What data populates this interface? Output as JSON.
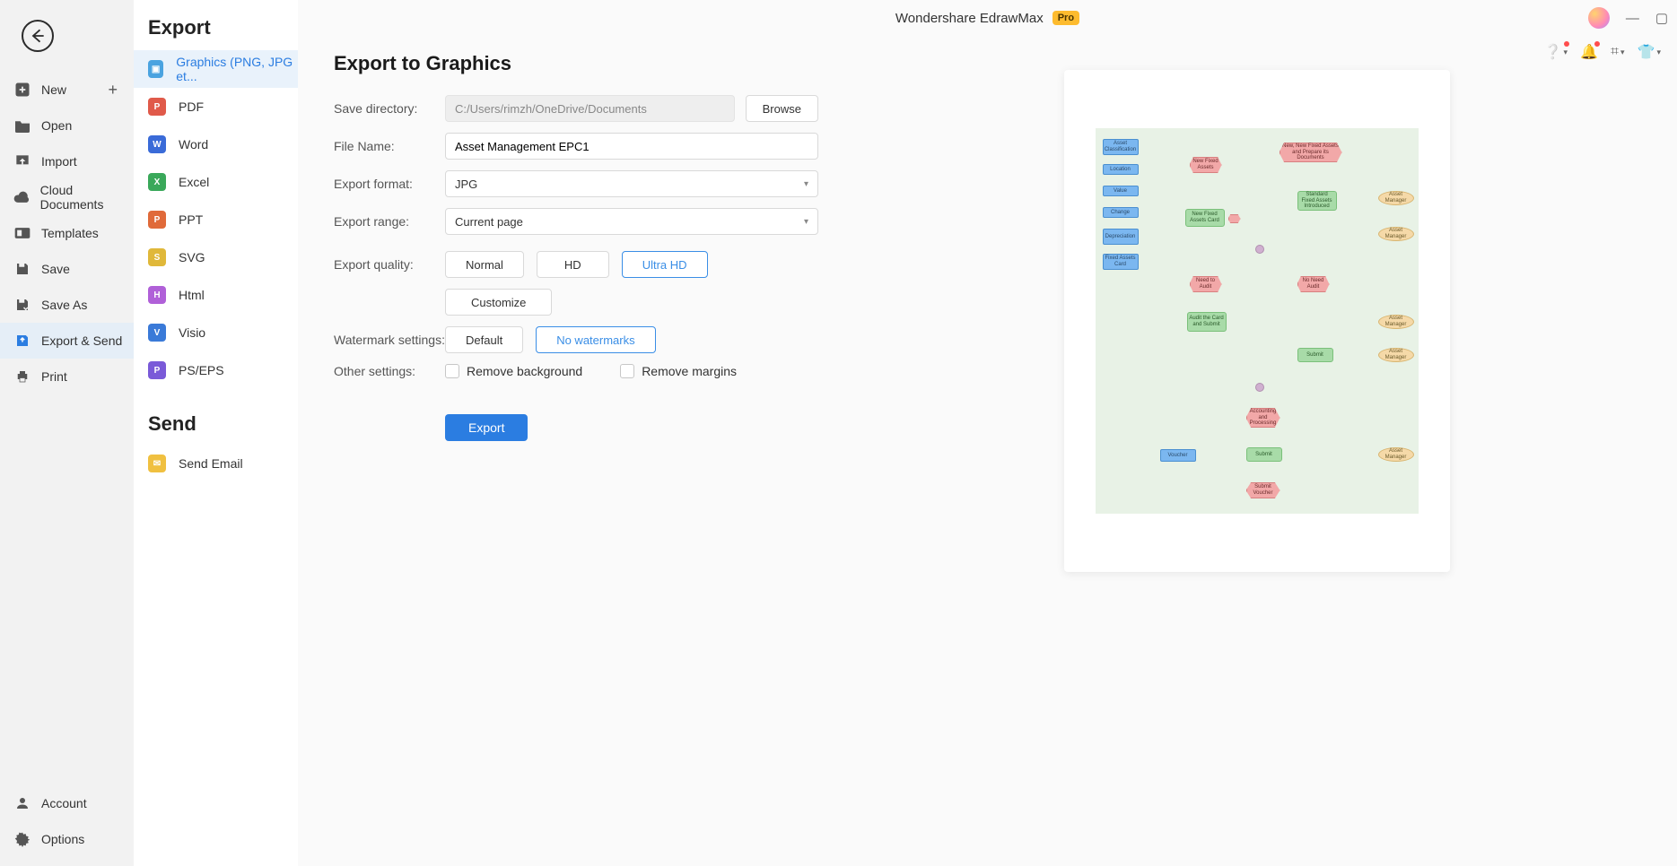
{
  "app": {
    "title": "Wondershare EdrawMax",
    "badge": "Pro"
  },
  "nav": {
    "items": [
      {
        "id": "new",
        "label": "New"
      },
      {
        "id": "open",
        "label": "Open"
      },
      {
        "id": "import",
        "label": "Import"
      },
      {
        "id": "cloud",
        "label": "Cloud Documents"
      },
      {
        "id": "templates",
        "label": "Templates"
      },
      {
        "id": "save",
        "label": "Save"
      },
      {
        "id": "saveas",
        "label": "Save As"
      },
      {
        "id": "export",
        "label": "Export & Send"
      },
      {
        "id": "print",
        "label": "Print"
      }
    ],
    "footer": [
      {
        "id": "account",
        "label": "Account"
      },
      {
        "id": "options",
        "label": "Options"
      }
    ]
  },
  "export_list": {
    "heading": "Export",
    "items": [
      {
        "id": "graphics",
        "label": "Graphics (PNG, JPG et...",
        "color": "#4aa3e0"
      },
      {
        "id": "pdf",
        "label": "PDF",
        "color": "#e05a4a"
      },
      {
        "id": "word",
        "label": "Word",
        "color": "#3a6bd8"
      },
      {
        "id": "excel",
        "label": "Excel",
        "color": "#3aa85a"
      },
      {
        "id": "ppt",
        "label": "PPT",
        "color": "#e06a3a"
      },
      {
        "id": "svg",
        "label": "SVG",
        "color": "#e0b83a"
      },
      {
        "id": "html",
        "label": "Html",
        "color": "#b060d8"
      },
      {
        "id": "visio",
        "label": "Visio",
        "color": "#3a7ad8"
      },
      {
        "id": "pseps",
        "label": "PS/EPS",
        "color": "#7a5ad8"
      }
    ],
    "send_heading": "Send",
    "send_items": [
      {
        "id": "email",
        "label": "Send Email",
        "color": "#f0c040"
      }
    ]
  },
  "form": {
    "title": "Export to Graphics",
    "labels": {
      "save_dir": "Save directory:",
      "file_name": "File Name:",
      "format": "Export format:",
      "range": "Export range:",
      "quality": "Export quality:",
      "watermark": "Watermark settings:",
      "other": "Other settings:"
    },
    "save_dir_value": "C:/Users/rimzh/OneDrive/Documents",
    "browse": "Browse",
    "file_name_value": "Asset Management EPC1",
    "format_value": "JPG",
    "range_value": "Current page",
    "quality_options": {
      "normal": "Normal",
      "hd": "HD",
      "uhd": "Ultra HD"
    },
    "customize": "Customize",
    "watermark_options": {
      "default": "Default",
      "none": "No watermarks"
    },
    "other_options": {
      "remove_bg": "Remove background",
      "remove_margins": "Remove margins"
    },
    "export_btn": "Export"
  },
  "preview_shapes": {
    "b1": "Asset Classification",
    "b2": "Location",
    "b3": "Value",
    "b4": "Change",
    "b5": "Depreciation",
    "b6": "Fixed Assets Card",
    "h1": "New Fixed Assets",
    "h2": "New, New Fixed Assets and Prepare its Documents",
    "g1": "New Fixed Assets Card",
    "g2": "Standard Fixed Assets Introduced",
    "g3": "Audit the Card and Submit",
    "g4": "Submit",
    "g5": "Submit",
    "o1": "Asset Manager",
    "o2": "Asset Manager",
    "o3": "Asset Manager",
    "o4": "Asset Manager",
    "o5": "Asset Manager",
    "h3": "Need to Audit",
    "h4": "No Need Audit",
    "h5": "Accounting and Processing",
    "h6": "Submit Voucher",
    "b7": "Voucher"
  }
}
